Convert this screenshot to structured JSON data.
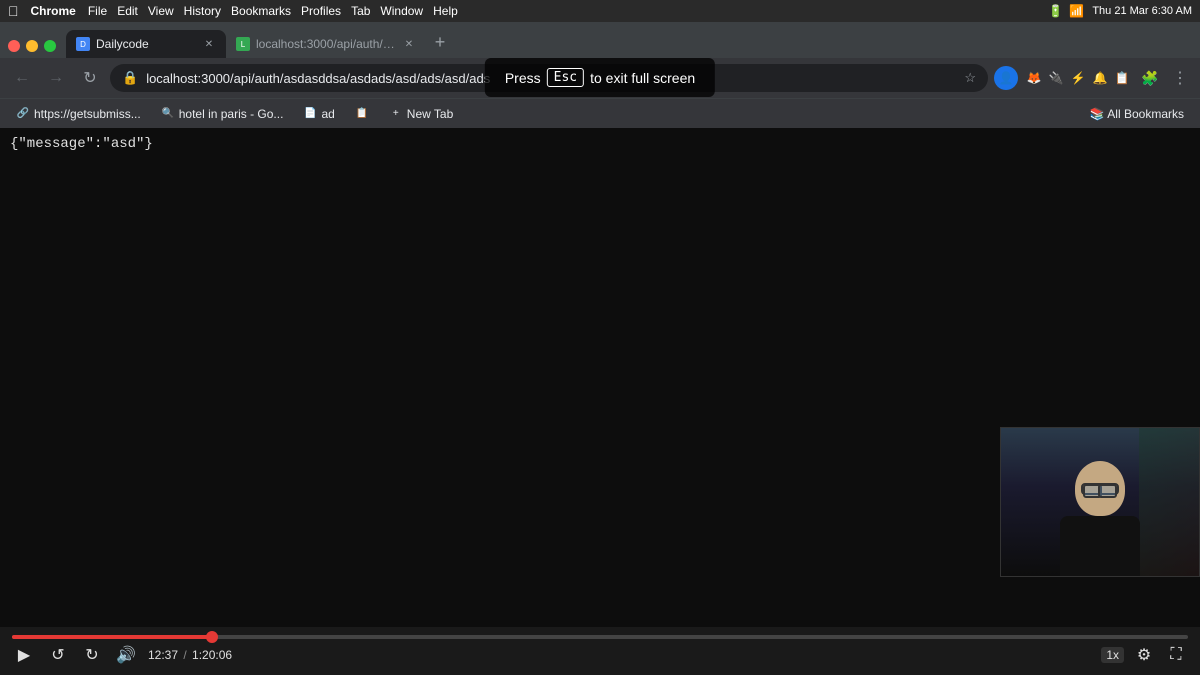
{
  "menubar": {
    "apple": "⌘",
    "app_name": "Chrome",
    "items": [
      "File",
      "Edit",
      "View",
      "History",
      "Bookmarks",
      "Profiles",
      "Tab",
      "Window",
      "Help"
    ],
    "right": {
      "datetime": "Thu 21 Mar  6:30 AM"
    }
  },
  "tabs": [
    {
      "id": "tab1",
      "favicon_letter": "D",
      "title": "Dailycode",
      "active": true
    },
    {
      "id": "tab2",
      "favicon_letter": "L",
      "title": "localhost:3000/api/auth/asd...",
      "active": false
    }
  ],
  "address_bar": {
    "url": "localhost:3000/api/auth/asdasddsa/asdads/asd/ads/asd/ads"
  },
  "bookmarks": [
    {
      "label": "https://getsubmiss...",
      "icon": "🔗"
    },
    {
      "label": "hotel in paris - Go...",
      "icon": "🔍"
    },
    {
      "label": "ad",
      "icon": "📄"
    },
    {
      "label": "",
      "icon": "📋"
    },
    {
      "label": "New Tab",
      "icon": "+"
    }
  ],
  "fullscreen_notice": {
    "press": "Press",
    "key": "Esc",
    "suffix": "to exit full screen"
  },
  "content": {
    "json_response": "{\"message\":\"asd\"}"
  },
  "video_controls": {
    "current_time": "12:37",
    "total_time": "1:20:06",
    "speed": "1x",
    "progress_percent": 17
  }
}
